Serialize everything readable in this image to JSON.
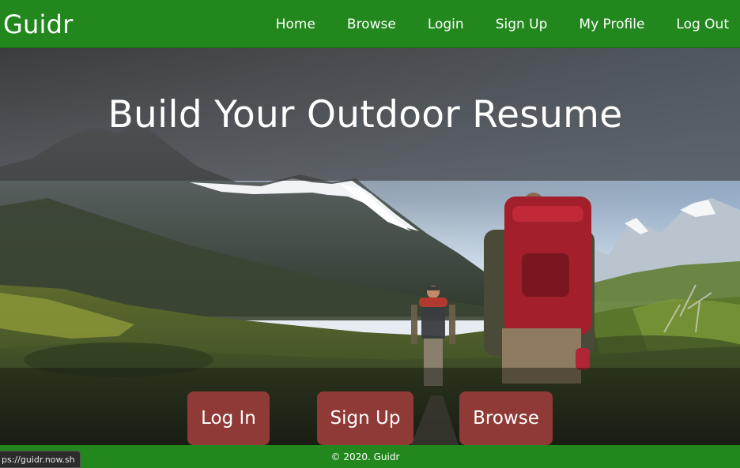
{
  "navbar": {
    "brand": "Guidr",
    "links": [
      "Home",
      "Browse",
      "Login",
      "Sign Up",
      "My Profile",
      "Log Out"
    ]
  },
  "hero": {
    "title": "Build Your Outdoor Resume",
    "buttons": {
      "login": "Log In",
      "signup": "Sign Up",
      "browse": "Browse"
    }
  },
  "footer": {
    "copyright": "© 2020. Guidr"
  },
  "status_bar": {
    "url": "ps://guidr.now.sh"
  },
  "colors": {
    "nav_green": "#22881d",
    "button_red": "#8f3a36"
  }
}
